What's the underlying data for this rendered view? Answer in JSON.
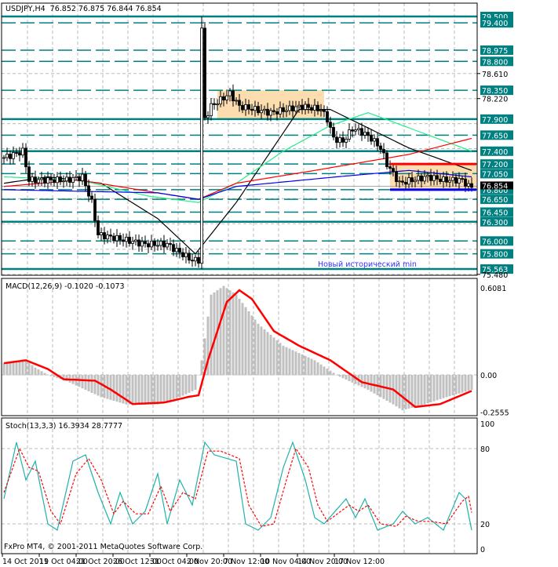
{
  "header": {
    "symbol_line": "USDJPY,H4  76.852 76.875 76.844 76.854"
  },
  "footer": {
    "copyright": "FxPro MT4, © 2001-2011 MetaQuotes Software Corp."
  },
  "colors": {
    "level": "#008080",
    "box": "#FBDDB0",
    "ma_black": "#000000",
    "ma_green": "#22EE88",
    "ma_red": "#FF0000",
    "ma_blue": "#0000EE",
    "histogram": "#C0C0C0",
    "signal": "#FF0000",
    "stoch_main": "#20B2AA",
    "stoch_signal": "#FF0000"
  },
  "chart_data": [
    {
      "type": "candlestick",
      "title": "USDJPY,H4",
      "ylim": [
        75.48,
        79.6
      ],
      "bars": 150,
      "x_tick_labels": [
        "14 Oct 2011",
        "19 Oct 04:00",
        "21 Oct 20:00",
        "26 Oct 12:00",
        "31 Oct 04:00",
        "2 Nov 20:00",
        "7 Nov 12:00",
        "10 Nov 04:00",
        "14 Nov 20:00",
        "17 Nov 12:00"
      ],
      "close_keypoints": [
        [
          0,
          77.3
        ],
        [
          3,
          77.35
        ],
        [
          6,
          77.4
        ],
        [
          8,
          76.95
        ],
        [
          12,
          76.95
        ],
        [
          20,
          76.95
        ],
        [
          25,
          77.0
        ],
        [
          28,
          76.6
        ],
        [
          30,
          76.1
        ],
        [
          40,
          76.0
        ],
        [
          45,
          75.95
        ],
        [
          52,
          75.95
        ],
        [
          55,
          75.85
        ],
        [
          60,
          75.7
        ],
        [
          62,
          75.7
        ],
        [
          63,
          79.3
        ],
        [
          64,
          77.9
        ],
        [
          66,
          78.1
        ],
        [
          72,
          78.3
        ],
        [
          75,
          78.1
        ],
        [
          85,
          78.0
        ],
        [
          95,
          78.1
        ],
        [
          101,
          78.05
        ],
        [
          103,
          77.9
        ],
        [
          105,
          77.6
        ],
        [
          108,
          77.55
        ],
        [
          111,
          77.75
        ],
        [
          114,
          77.7
        ],
        [
          117,
          77.6
        ],
        [
          120,
          77.45
        ],
        [
          122,
          77.2
        ],
        [
          124,
          77.05
        ],
        [
          126,
          76.9
        ],
        [
          130,
          76.95
        ],
        [
          135,
          77.0
        ],
        [
          140,
          76.95
        ],
        [
          146,
          76.95
        ],
        [
          148,
          76.85
        ]
      ],
      "spike": {
        "bar": 63,
        "high": 79.5,
        "low": 75.56
      },
      "levels": [
        {
          "price": "79.500",
          "style": "solid"
        },
        {
          "price": "79.400",
          "style": "dash"
        },
        {
          "price": "78.975",
          "style": "dash"
        },
        {
          "price": "78.800",
          "style": "dash"
        },
        {
          "price": "78.350",
          "style": "dash"
        },
        {
          "price": "77.900",
          "style": "solid"
        },
        {
          "price": "77.650",
          "style": "dash"
        },
        {
          "price": "77.400",
          "style": "solid"
        },
        {
          "price": "77.200",
          "style": "dash"
        },
        {
          "price": "77.050",
          "style": "dash"
        },
        {
          "price": "76.800",
          "style": "dash"
        },
        {
          "price": "76.650",
          "style": "dash"
        },
        {
          "price": "76.450",
          "style": "dash"
        },
        {
          "price": "76.300",
          "style": "solid"
        },
        {
          "price": "76.000",
          "style": "dash"
        },
        {
          "price": "75.800",
          "style": "dash"
        },
        {
          "price": "75.563",
          "style": "solid"
        }
      ],
      "axis_ticks": [
        "78.610",
        "78.220",
        "75.480"
      ],
      "current_price": "76.854",
      "boxes": [
        {
          "from_bar": 68,
          "to_bar": 102,
          "top": 78.35,
          "bottom": 77.9
        },
        {
          "from_bar": 123,
          "to_bar": 151,
          "top": 77.2,
          "bottom": 76.8
        }
      ],
      "range_lines": [
        {
          "from_bar": 123,
          "to_bar": 151,
          "price": 77.2,
          "color": "#FF0000"
        },
        {
          "from_bar": 123,
          "to_bar": 151,
          "price": 76.8,
          "color": "#0000EE"
        }
      ],
      "annotation": "Новый исторический min",
      "moving_averages": {
        "black": [
          [
            0,
            76.9
          ],
          [
            14,
            77.0
          ],
          [
            31,
            76.9
          ],
          [
            49,
            76.35
          ],
          [
            61,
            75.8
          ],
          [
            74,
            76.6
          ],
          [
            94,
            78.05
          ],
          [
            104,
            78.05
          ],
          [
            129,
            77.45
          ],
          [
            149,
            77.1
          ]
        ],
        "green": [
          [
            0,
            77.0
          ],
          [
            24,
            76.95
          ],
          [
            46,
            76.7
          ],
          [
            62,
            76.6
          ],
          [
            74,
            76.9
          ],
          [
            89,
            77.4
          ],
          [
            104,
            77.8
          ],
          [
            116,
            78.0
          ],
          [
            149,
            77.4
          ]
        ],
        "red": [
          [
            0,
            76.85
          ],
          [
            24,
            76.95
          ],
          [
            49,
            76.75
          ],
          [
            62,
            76.65
          ],
          [
            74,
            76.9
          ],
          [
            99,
            77.1
          ],
          [
            129,
            77.35
          ],
          [
            149,
            77.6
          ]
        ],
        "blue": [
          [
            0,
            76.8
          ],
          [
            49,
            76.75
          ],
          [
            62,
            76.65
          ],
          [
            74,
            76.85
          ],
          [
            106,
            77.0
          ],
          [
            129,
            77.1
          ],
          [
            149,
            77.0
          ]
        ]
      }
    },
    {
      "type": "bar",
      "title": "MACD(12,26,9) -0.1020 -0.1073",
      "ylim": [
        -0.2555,
        0.6081
      ],
      "y_tick_labels": [
        "0.6081",
        "0.00",
        "-0.2555"
      ],
      "histogram_keypoints": [
        [
          0,
          0.08
        ],
        [
          7,
          0.1
        ],
        [
          10,
          0.05
        ],
        [
          14,
          0.0
        ],
        [
          19,
          -0.03
        ],
        [
          31,
          -0.15
        ],
        [
          39,
          -0.2
        ],
        [
          49,
          -0.2
        ],
        [
          56,
          -0.15
        ],
        [
          61,
          -0.1
        ],
        [
          63,
          0.1
        ],
        [
          66,
          0.55
        ],
        [
          70,
          0.61
        ],
        [
          74,
          0.55
        ],
        [
          81,
          0.35
        ],
        [
          89,
          0.2
        ],
        [
          99,
          0.1
        ],
        [
          106,
          0.0
        ],
        [
          116,
          -0.1
        ],
        [
          124,
          -0.2
        ],
        [
          127,
          -0.24
        ],
        [
          134,
          -0.2
        ],
        [
          141,
          -0.15
        ],
        [
          149,
          -0.1
        ]
      ],
      "signal_keypoints": [
        [
          0,
          0.08
        ],
        [
          7,
          0.1
        ],
        [
          14,
          0.04
        ],
        [
          19,
          -0.03
        ],
        [
          29,
          -0.04
        ],
        [
          34,
          -0.1
        ],
        [
          41,
          -0.2
        ],
        [
          51,
          -0.19
        ],
        [
          59,
          -0.15
        ],
        [
          62,
          -0.14
        ],
        [
          65,
          0.1
        ],
        [
          71,
          0.5
        ],
        [
          75,
          0.58
        ],
        [
          79,
          0.52
        ],
        [
          86,
          0.3
        ],
        [
          94,
          0.2
        ],
        [
          104,
          0.1
        ],
        [
          114,
          -0.05
        ],
        [
          124,
          -0.1
        ],
        [
          131,
          -0.22
        ],
        [
          139,
          -0.2
        ],
        [
          149,
          -0.11
        ]
      ]
    },
    {
      "type": "line",
      "title": "Stoch(13,3,3) 16.3934 28.7777",
      "ylim": [
        0,
        100
      ],
      "y_tick_labels": [
        "100",
        "80",
        "20",
        "0"
      ],
      "main_keypoints": [
        [
          0,
          40
        ],
        [
          4,
          85
        ],
        [
          7,
          55
        ],
        [
          10,
          70
        ],
        [
          14,
          20
        ],
        [
          17,
          15
        ],
        [
          22,
          70
        ],
        [
          26,
          75
        ],
        [
          30,
          45
        ],
        [
          34,
          20
        ],
        [
          37,
          45
        ],
        [
          41,
          20
        ],
        [
          45,
          30
        ],
        [
          49,
          60
        ],
        [
          52,
          20
        ],
        [
          56,
          55
        ],
        [
          60,
          35
        ],
        [
          64,
          85
        ],
        [
          67,
          75
        ],
        [
          74,
          70
        ],
        [
          77,
          20
        ],
        [
          81,
          15
        ],
        [
          85,
          25
        ],
        [
          89,
          65
        ],
        [
          92,
          85
        ],
        [
          96,
          55
        ],
        [
          99,
          25
        ],
        [
          102,
          20
        ],
        [
          109,
          40
        ],
        [
          112,
          25
        ],
        [
          115,
          40
        ],
        [
          119,
          15
        ],
        [
          124,
          20
        ],
        [
          127,
          30
        ],
        [
          131,
          20
        ],
        [
          135,
          25
        ],
        [
          140,
          15
        ],
        [
          145,
          45
        ],
        [
          147,
          40
        ],
        [
          149,
          15
        ]
      ],
      "signal_keypoints": [
        [
          0,
          45
        ],
        [
          5,
          80
        ],
        [
          8,
          65
        ],
        [
          11,
          62
        ],
        [
          15,
          30
        ],
        [
          18,
          20
        ],
        [
          23,
          60
        ],
        [
          27,
          72
        ],
        [
          31,
          55
        ],
        [
          35,
          28
        ],
        [
          38,
          38
        ],
        [
          42,
          28
        ],
        [
          46,
          28
        ],
        [
          50,
          50
        ],
        [
          53,
          30
        ],
        [
          57,
          45
        ],
        [
          61,
          40
        ],
        [
          65,
          78
        ],
        [
          69,
          78
        ],
        [
          75,
          72
        ],
        [
          78,
          35
        ],
        [
          82,
          18
        ],
        [
          86,
          20
        ],
        [
          90,
          55
        ],
        [
          93,
          80
        ],
        [
          97,
          65
        ],
        [
          100,
          35
        ],
        [
          103,
          22
        ],
        [
          110,
          35
        ],
        [
          113,
          30
        ],
        [
          116,
          35
        ],
        [
          120,
          20
        ],
        [
          125,
          18
        ],
        [
          128,
          26
        ],
        [
          132,
          22
        ],
        [
          136,
          22
        ],
        [
          141,
          20
        ],
        [
          146,
          38
        ],
        [
          148,
          42
        ],
        [
          149,
          29
        ]
      ]
    }
  ]
}
